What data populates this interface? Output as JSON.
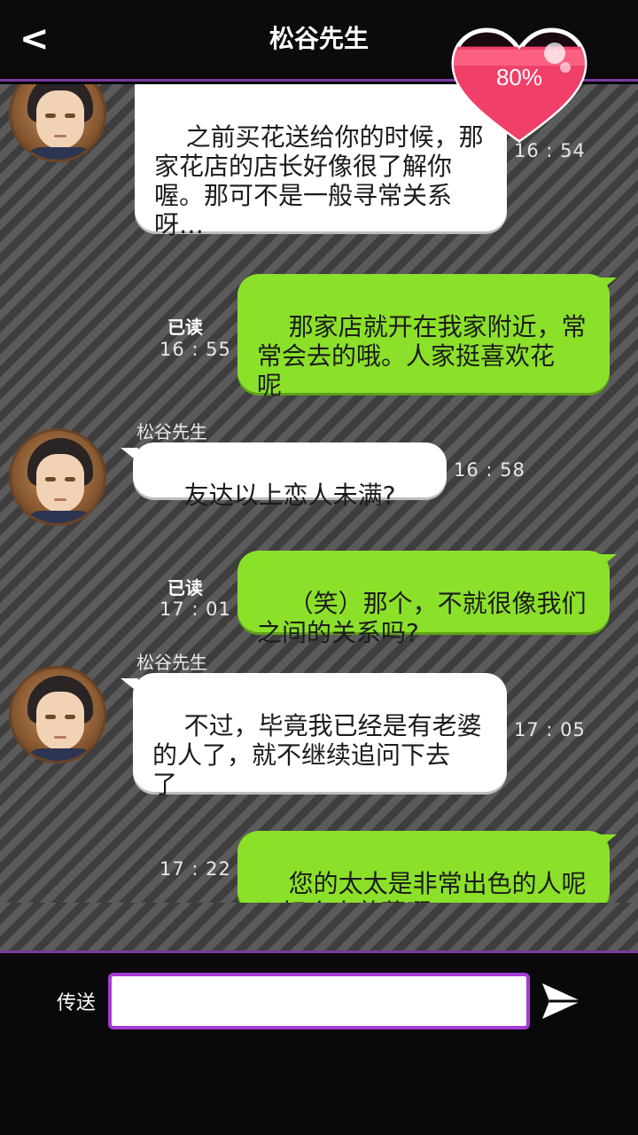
{
  "header": {
    "back_label": "<",
    "title": "松谷先生"
  },
  "affection": {
    "percent_label": "80%",
    "value": 0.8
  },
  "messages": [
    {
      "side": "left",
      "sender": "",
      "text": "之前买花送给你的时候，那\n家花店的店长好像很了解你\n喔。那可不是一般寻常关系\n呀…",
      "time": "16 : 54",
      "read": ""
    },
    {
      "side": "right",
      "sender": "",
      "text": "那家店就开在我家附近，常\n常会去的哦。人家挺喜欢花\n呢",
      "time": "16 : 55",
      "read": "已读"
    },
    {
      "side": "left",
      "sender": "松谷先生",
      "text": "友达以上恋人未满?",
      "time": "16 : 58",
      "read": ""
    },
    {
      "side": "right",
      "sender": "",
      "text": "（笑）那个，不就很像我们\n之间的关系吗?",
      "time": "17 : 01",
      "read": "已读"
    },
    {
      "side": "left",
      "sender": "松谷先生",
      "text": "不过，毕竟我已经是有老婆\n的人了，就不继续追问下去\n了",
      "time": "17 : 05",
      "read": ""
    },
    {
      "side": "right",
      "sender": "",
      "text": "您的太太是非常出色的人呢\n…好令人羡慕啊",
      "time": "17 : 22",
      "read": ""
    }
  ],
  "input": {
    "label": "传送",
    "value": "",
    "placeholder": ""
  },
  "colors": {
    "accent": "#a63ad6",
    "bubble_right": "#8be02a",
    "bubble_left": "#ffffff",
    "heart": "#f0406a"
  },
  "icons": {
    "back": "chevron-left-icon",
    "send": "paper-plane-icon",
    "heart": "heart-icon"
  }
}
